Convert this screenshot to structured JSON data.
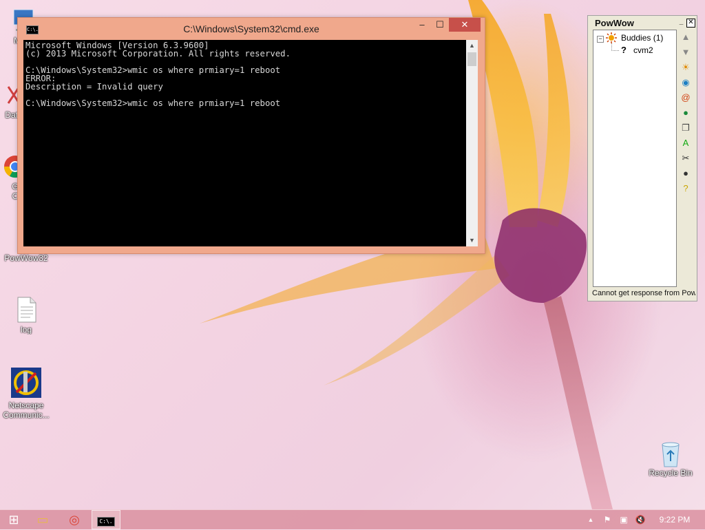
{
  "desktop_icons": [
    {
      "name": "my-computer",
      "label": "My C",
      "icon": "computer-icon"
    },
    {
      "name": "data",
      "label": "Data",
      "icon": "data-icon"
    },
    {
      "name": "google-chrome",
      "label": "G\nC",
      "icon": "chrome-icon"
    },
    {
      "name": "powwow32",
      "label": "PowWow32",
      "icon": "powwow-icon"
    },
    {
      "name": "log",
      "label": "log",
      "icon": "text-file-icon"
    },
    {
      "name": "netscape",
      "label": "Netscape\nCommunic...",
      "icon": "netscape-icon"
    },
    {
      "name": "recycle-bin",
      "label": "Recycle Bin",
      "icon": "recycle-bin-icon"
    }
  ],
  "cmd": {
    "title": "C:\\Windows\\System32\\cmd.exe",
    "icon_text": "C:\\.",
    "lines": [
      "Microsoft Windows [Version 6.3.9600]",
      "(c) 2013 Microsoft Corporation. All rights reserved.",
      "",
      "C:\\Windows\\System32>wmic os where prmiary=1 reboot",
      "ERROR:",
      "Description = Invalid query",
      "",
      "C:\\Windows\\System32>wmic os where prmiary=1 reboot"
    ],
    "buttons": {
      "minimize": "–",
      "maximize": "☐",
      "close": "✕"
    }
  },
  "powwow": {
    "title": "PowWow",
    "minimize": "_",
    "close": "✕",
    "tree": {
      "group_label": "Buddies (1)",
      "expander": "−",
      "buddy": "cvm2"
    },
    "status": "Cannot get response from Pow",
    "tools": [
      {
        "name": "scroll-up-icon",
        "glyph": "▲",
        "color": "#888888"
      },
      {
        "name": "scroll-down-icon",
        "glyph": "▼",
        "color": "#888888"
      },
      {
        "name": "sun-icon",
        "glyph": "☀",
        "color": "#e08a00"
      },
      {
        "name": "globe-icon",
        "glyph": "◉",
        "color": "#1c7fc4"
      },
      {
        "name": "spiral-icon",
        "glyph": "@",
        "color": "#d04010"
      },
      {
        "name": "earth-icon",
        "glyph": "●",
        "color": "#1a8a3a"
      },
      {
        "name": "windows-icon",
        "glyph": "❐",
        "color": "#444444"
      },
      {
        "name": "font-icon",
        "glyph": "A",
        "color": "#11aa11"
      },
      {
        "name": "tools-icon",
        "glyph": "✂",
        "color": "#333333"
      },
      {
        "name": "chat-icon",
        "glyph": "●",
        "color": "#333333"
      },
      {
        "name": "help-icon",
        "glyph": "?",
        "color": "#c9a600"
      }
    ]
  },
  "taskbar": {
    "start_glyph": "⊞",
    "explorer_glyph": "▭",
    "chrome_glyph": "◎",
    "cmd_glyph": "C:\\.",
    "tray_arrow": "▲",
    "tray_items": [
      {
        "name": "network-error-icon",
        "glyph": "⚑"
      },
      {
        "name": "network-icon",
        "glyph": "▣"
      },
      {
        "name": "volume-muted-icon",
        "glyph": "🔇"
      }
    ],
    "clock": "9:22 PM"
  },
  "colors": {
    "cmd_title_bg": "#f0a88c",
    "close_red": "#c7504a",
    "taskbar": "#dc96a5"
  }
}
